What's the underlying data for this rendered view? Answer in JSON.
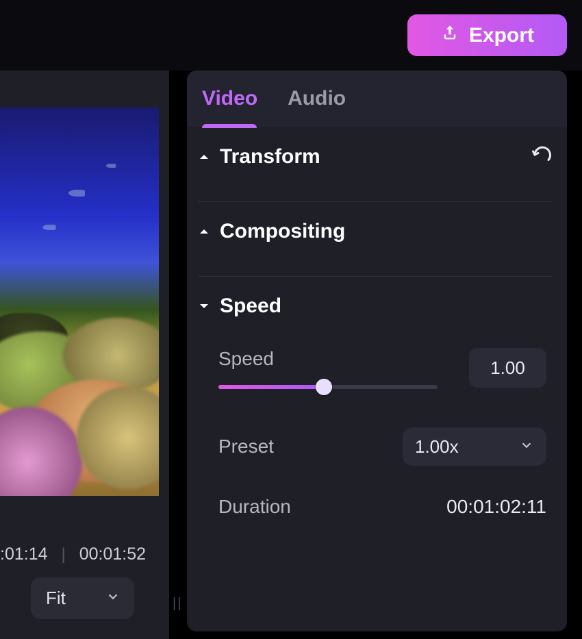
{
  "header": {
    "export_label": "Export"
  },
  "preview": {
    "time_current": ":01:14",
    "time_total": "00:01:52",
    "fit_label": "Fit"
  },
  "tabs": {
    "items": [
      {
        "label": "Video"
      },
      {
        "label": "Audio"
      }
    ],
    "active_index": 0
  },
  "sections": {
    "transform": {
      "title": "Transform"
    },
    "compositing": {
      "title": "Compositing"
    },
    "speed": {
      "title": "Speed",
      "speed_label": "Speed",
      "speed_value": "1.00",
      "slider_percent": 48,
      "preset_label": "Preset",
      "preset_value": "1.00x",
      "duration_label": "Duration",
      "duration_value": "00:01:02:11"
    }
  }
}
